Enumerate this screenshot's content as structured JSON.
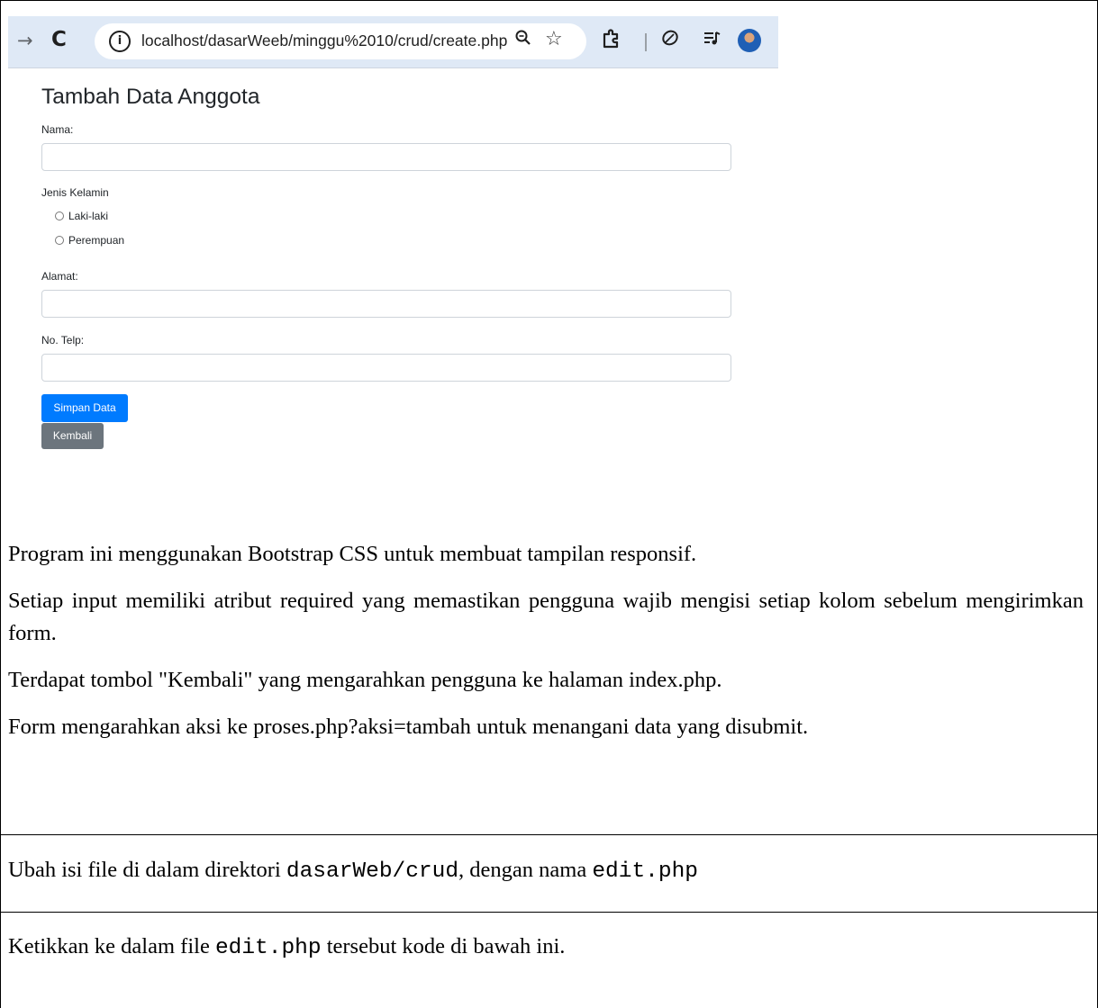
{
  "browser": {
    "url": "localhost/dasarWeeb/minggu%2010/crud/create.php",
    "icons": [
      "back-icon",
      "reload-icon",
      "info-icon",
      "zoom-icon",
      "star-icon",
      "extensions-icon",
      "leaf-icon",
      "media-icon",
      "avatar"
    ]
  },
  "form": {
    "title": "Tambah Data Anggota",
    "nama_label": "Nama:",
    "gender_label": "Jenis Kelamin",
    "gender_options": [
      "Laki-laki",
      "Perempuan"
    ],
    "alamat_label": "Alamat:",
    "telp_label": "No. Telp:",
    "submit_label": "Simpan Data",
    "back_label": "Kembali"
  },
  "doc": {
    "p1": "Program ini menggunakan Bootstrap CSS untuk membuat tampilan responsif.",
    "p2": "Setiap input memiliki atribut required yang memastikan pengguna wajib mengisi setiap kolom sebelum mengirimkan form.",
    "p3": "Terdapat tombol \"Kembali\" yang mengarahkan pengguna ke halaman index.php.",
    "p4": "Form mengarahkan aksi ke proses.php?aksi=tambah untuk menangani data yang disubmit.",
    "step1": {
      "pre": "Ubah isi file di dalam direktori ",
      "dir": "dasarWeb/crud",
      "mid": ", dengan nama ",
      "file": "edit.php"
    },
    "step2": {
      "pre": "Ketikkan ke dalam file ",
      "file": "edit.php",
      "post": " tersebut kode di bawah ini."
    }
  }
}
